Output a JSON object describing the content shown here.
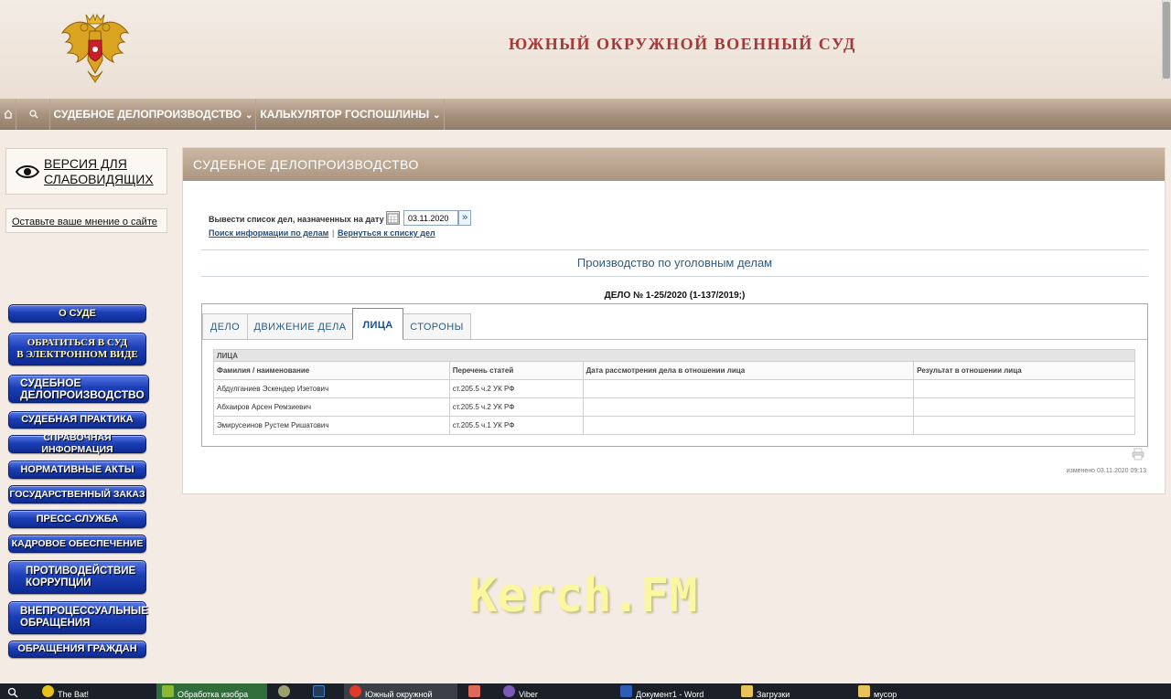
{
  "header": {
    "court_title": "ЮЖНЫЙ ОКРУЖНОЙ ВОЕННЫЙ СУД"
  },
  "nav": {
    "home_icon": "home-icon",
    "search_icon": "search-icon",
    "items": [
      {
        "label": "СУДЕБНОЕ ДЕЛОПРОИЗВОДСТВО"
      },
      {
        "label": "КАЛЬКУЛЯТОР ГОСПОШЛИНЫ"
      }
    ]
  },
  "sidebar": {
    "accessibility_label": "ВЕРСИЯ ДЛЯ СЛАБОВИДЯЩИХ",
    "feedback_link": "Оставьте ваше мнение о сайте",
    "menu": [
      {
        "label": "О СУДЕ"
      },
      {
        "label": "ОБРАТИТЬСЯ В СУД",
        "label2": "В ЭЛЕКТРОННОМ ВИДЕ"
      },
      {
        "label": "СУДЕБНОЕ",
        "label2": "ДЕЛОПРОИЗВОДСТВО"
      },
      {
        "label": "СУДЕБНАЯ ПРАКТИКА"
      },
      {
        "label": "СПРАВОЧНАЯ ИНФОРМАЦИЯ"
      },
      {
        "label": "НОРМАТИВНЫЕ АКТЫ"
      },
      {
        "label": "ГОСУДАРСТВЕННЫЙ ЗАКАЗ"
      },
      {
        "label": "ПРЕСС-СЛУЖБА"
      },
      {
        "label": "КАДРОВОЕ ОБЕСПЕЧЕНИЕ"
      },
      {
        "label": "ПРОТИВОДЕЙСТВИЕ",
        "label2": "КОРРУПЦИИ"
      },
      {
        "label": "ВНЕПРОЦЕССУАЛЬНЫЕ",
        "label2": "ОБРАЩЕНИЯ"
      },
      {
        "label": "ОБРАЩЕНИЯ ГРАЖДАН"
      }
    ]
  },
  "main": {
    "panel_title": "СУДЕБНОЕ ДЕЛОПРОИЗВОДСТВО",
    "date_label": "Вывести список дел, назначенных на дату",
    "date_value": "03.11.2020",
    "link_search": "Поиск информации по делам",
    "link_separator": "|",
    "link_back": "Вернуться к списку дел",
    "section_title": "Производство по уголовным делам",
    "case_number": "ДЕЛО № 1-25/2020 (1-137/2019;)",
    "tabs": [
      {
        "label": "ДЕЛО"
      },
      {
        "label": "ДВИЖЕНИЕ ДЕЛА"
      },
      {
        "label": "ЛИЦА"
      },
      {
        "label": "СТОРОНЫ"
      }
    ],
    "active_tab": "ЛИЦА",
    "table": {
      "group_title": "ЛИЦА",
      "columns": [
        "Фамилия / наименование",
        "Перечень статей",
        "Дата рассмотрения дела в отношении лица",
        "Результат в отношении лица"
      ],
      "rows": [
        [
          "Абдулганиев Эскендер Изетович",
          "ст.205.5 ч.2 УК РФ",
          "",
          ""
        ],
        [
          "Абхаиров Арсен Ремзиевич",
          "ст.205.5 ч.2 УК РФ",
          "",
          ""
        ],
        [
          "Эмирусеинов Рустем Ришатович",
          "ст.205.5 ч.1 УК РФ",
          "",
          ""
        ]
      ]
    },
    "modified": "изменено 03.11.2020 09:13"
  },
  "watermark": "Kerch.FM",
  "taskbar": {
    "items": [
      {
        "label": "The Bat!"
      },
      {
        "label": "Обработка изобра"
      },
      {
        "label": ""
      },
      {
        "label": ""
      },
      {
        "label": "Южный окружной"
      },
      {
        "label": ""
      },
      {
        "label": "Viber"
      },
      {
        "label": "Документ1 - Word"
      },
      {
        "label": "Загрузки"
      },
      {
        "label": "мусор"
      }
    ]
  }
}
